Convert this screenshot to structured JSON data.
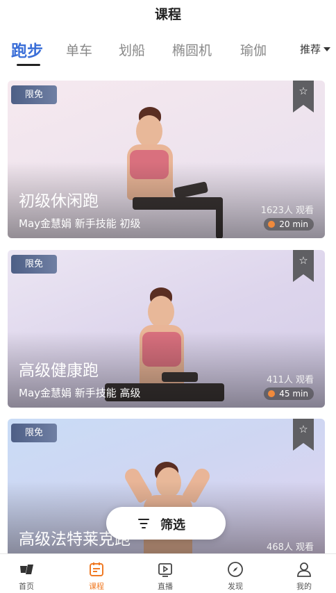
{
  "header": {
    "title": "课程"
  },
  "tabs": [
    {
      "label": "跑步",
      "active": true
    },
    {
      "label": "单车"
    },
    {
      "label": "划船"
    },
    {
      "label": "椭圆机"
    },
    {
      "label": "瑜伽"
    }
  ],
  "sort": {
    "label": "推荐"
  },
  "courses": [
    {
      "badge": "限免",
      "title": "初级休闲跑",
      "subtitle": "May金慧娟 新手技能 初级",
      "viewers": "1623人 观看",
      "duration": "20 min"
    },
    {
      "badge": "限免",
      "title": "高级健康跑",
      "subtitle": "May金慧娟 新手技能 高级",
      "viewers": "411人 观看",
      "duration": "45 min"
    },
    {
      "badge": "限免",
      "title": "高级法特莱克跑",
      "viewers": "468人 观看"
    }
  ],
  "filter": {
    "label": "筛选"
  },
  "nav": [
    {
      "label": "首页",
      "icon": "home-logo-icon"
    },
    {
      "label": "课程",
      "icon": "calendar-icon",
      "active": true
    },
    {
      "label": "直播",
      "icon": "live-play-icon"
    },
    {
      "label": "发现",
      "icon": "compass-icon"
    },
    {
      "label": "我的",
      "icon": "user-icon"
    }
  ],
  "colors": {
    "accent_blue": "#3b6fd8",
    "accent_orange": "#f07a24",
    "badge": "#4e5f86"
  }
}
